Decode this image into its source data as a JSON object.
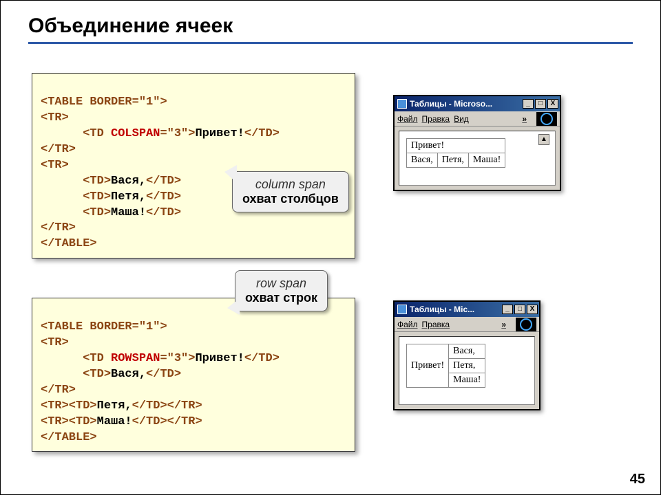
{
  "title": "Объединение ячеек",
  "page_number": "45",
  "code1": {
    "l1a": "<TABLE BORDER=",
    "l1b": "\"1\"",
    "l1c": ">",
    "l2": "<TR>",
    "l3a": "      <TD ",
    "l3b": "COLSPAN",
    "l3c": "=",
    "l3d": "\"3\"",
    "l3e": ">",
    "l3f": "Привет!",
    "l3g": "</TD>",
    "l4": "</TR>",
    "l5": "<TR>",
    "l6a": "      <TD>",
    "l6b": "Вася,",
    "l6c": "</TD>",
    "l7a": "      <TD>",
    "l7b": "Петя,",
    "l7c": "</TD>",
    "l8a": "      <TD>",
    "l8b": "Маша!",
    "l8c": "</TD>",
    "l9": "</TR>",
    "l10": "</TABLE>"
  },
  "code2": {
    "l1a": "<TABLE BORDER=",
    "l1b": "\"1\"",
    "l1c": ">",
    "l2": "<TR>",
    "l3a": "      <TD ",
    "l3b": "ROWSPAN",
    "l3c": "=",
    "l3d": "\"3\"",
    "l3e": ">",
    "l3f": "Привет!",
    "l3g": "</TD>",
    "l4a": "      <TD>",
    "l4b": "Вася,",
    "l4c": "</TD>",
    "l5": "</TR>",
    "l6a": "<TR><TD>",
    "l6b": "Петя,",
    "l6c": "</TD></TR>",
    "l7a": "<TR><TD>",
    "l7b": "Маша!",
    "l7c": "</TD></TR>",
    "l8": "</TABLE>"
  },
  "callout1": {
    "line1": "column span",
    "line2": "охват столбцов"
  },
  "callout2": {
    "line1": "row span",
    "line2": "охват строк"
  },
  "browser1": {
    "title": "Таблицы - Microso...",
    "menu": [
      "Файл",
      "Правка",
      "Вид"
    ],
    "chev": "»",
    "cells": {
      "r1c1": "Привет!",
      "r2c1": "Вася,",
      "r2c2": "Петя,",
      "r2c3": "Маша!"
    }
  },
  "browser2": {
    "title": "Таблицы - Mic...",
    "menu": [
      "Файл",
      "Правка"
    ],
    "chev": "»",
    "cells": {
      "c1": "Привет!",
      "r1": "Вася,",
      "r2": "Петя,",
      "r3": "Маша!"
    }
  },
  "win_buttons": {
    "min": "_",
    "max": "□",
    "close": "X"
  }
}
